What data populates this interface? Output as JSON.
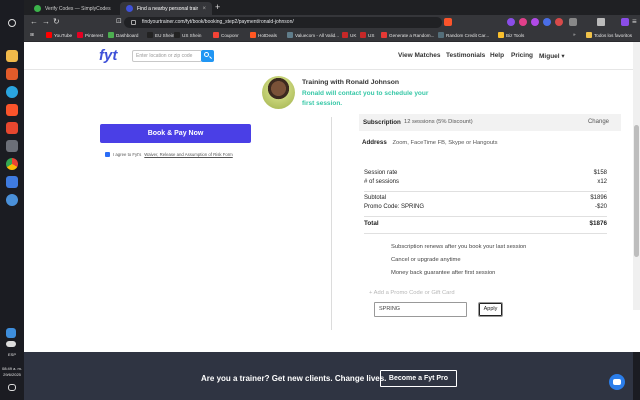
{
  "os": {
    "lang": "ESP",
    "time": "08:49 a. m.",
    "date": "29/6/2025"
  },
  "browser": {
    "tabs": [
      {
        "label": "Verify Codes — SimplyCodes",
        "active": false
      },
      {
        "label": "Find a nearby personal trainer or...",
        "active": true
      }
    ],
    "new_tab": "+",
    "url": "findyourtrainer.com/fyt/book/booking_step2/payment/ronald-johnson/",
    "bookmarks": [
      {
        "label": "YouTube",
        "color": "#ff0000"
      },
      {
        "label": "Pinterest",
        "color": "#e60023"
      },
      {
        "label": "Dashboard",
        "color": "#4caf50"
      },
      {
        "label": "EU Shein",
        "color": "#222"
      },
      {
        "label": "US Shein",
        "color": "#222"
      },
      {
        "label": "Couponr",
        "color": "#f44336"
      },
      {
        "label": "HotDeals",
        "color": "#ff5722"
      },
      {
        "label": "Valuecom - All Valid...",
        "color": "#607d8b"
      },
      {
        "label": "UK",
        "color": "#c62828"
      },
      {
        "label": "US",
        "color": "#c62828"
      },
      {
        "label": "Generate a Random...",
        "color": "#e53935"
      },
      {
        "label": "Random Credit Car...",
        "color": "#546e7a"
      },
      {
        "label": "Biz Tools",
        "color": "#fbc02d"
      }
    ],
    "bookmarks_more": "»",
    "all_bookmarks": "Todos los favoritos"
  },
  "header": {
    "logo": "fyt",
    "search_placeholder": "Enter location or zip code",
    "nav": [
      "View Matches",
      "Testimonials",
      "Help",
      "Pricing"
    ],
    "user": "Miguel ▾"
  },
  "trainer": {
    "title": "Training with Ronald Johnson",
    "subtitle": "Ronald will contact you to schedule your first session."
  },
  "payment": {
    "pay_button": "Book & Pay Now",
    "agree_prefix": "I agree to Fyt's",
    "agree_link": "Waiver, Release and Assumption of Risk Form"
  },
  "subscription": {
    "label": "Subscription",
    "value": "12 sessions (5% Discount)",
    "change": "Change"
  },
  "address": {
    "label": "Address",
    "value": "Zoom, FaceTime FB, Skype or Hangouts"
  },
  "summary": {
    "session_rate_label": "Session rate",
    "session_rate": "$158",
    "num_sessions_label": "# of sessions",
    "num_sessions": "x12",
    "subtotal_label": "Subtotal",
    "subtotal": "$1896",
    "promo_label": "Promo Code: SPRING",
    "promo_value": "-$20",
    "total_label": "Total",
    "total": "$1876"
  },
  "perks": [
    "Subscription renews after you book your last session",
    "Cancel or upgrade anytime",
    "Money back guarantee after first session"
  ],
  "promo": {
    "link": "+ Add a Promo Code or Gift Card",
    "input_value": "SPRING",
    "apply": "Apply"
  },
  "footer": {
    "text": "Are you a trainer? Get new clients. Change lives.",
    "button": "Become a Fyt Pro"
  }
}
